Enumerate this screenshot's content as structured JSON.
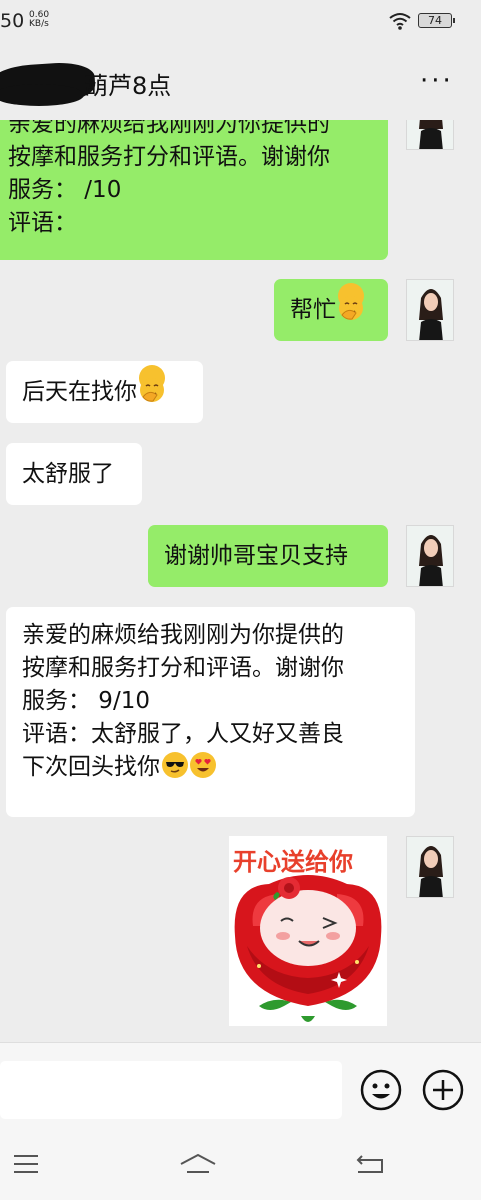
{
  "status_bar": {
    "time_partial": "50",
    "speed_value": "0.60",
    "speed_unit": "KB/s",
    "battery": "74",
    "icons": [
      "wifi-icon",
      "battery-icon"
    ]
  },
  "header": {
    "title": "葫芦8点",
    "more_label": "···",
    "icons": [
      "more-icon"
    ]
  },
  "messages": [
    {
      "side": "right",
      "lines": [
        "亲爱的麻烦给我刚刚为你提供的",
        "按摩和服务打分和评语。谢谢你",
        "服务：  /10",
        "评语："
      ]
    },
    {
      "side": "right",
      "text": "帮忙",
      "emoji": "facepalm-emoji"
    },
    {
      "side": "left",
      "text": "后天在找你",
      "emoji": "facepalm-emoji"
    },
    {
      "side": "left",
      "text": "太舒服了"
    },
    {
      "side": "right",
      "text": "谢谢帅哥宝贝支持"
    },
    {
      "side": "left",
      "lines": [
        "亲爱的麻烦给我刚刚为你提供的",
        "按摩和服务打分和评语。谢谢你",
        "服务：  9/10",
        "评语：太舒服了，人又好又善良",
        "下次回头找你"
      ],
      "emojis": [
        "sunglasses-emoji",
        "heart-eyes-emoji"
      ]
    },
    {
      "side": "right",
      "type": "sticker",
      "caption": "开心送给你"
    }
  ],
  "input_bar": {
    "icons": [
      "emoji-icon",
      "plus-icon"
    ]
  },
  "nav_bar": {
    "icons": [
      "menu-icon",
      "home-icon",
      "back-icon"
    ]
  },
  "colors": {
    "background": "#ededed",
    "bubble_sent": "#95ec69",
    "bubble_received": "#ffffff",
    "sticker_text": "#e8402c"
  }
}
